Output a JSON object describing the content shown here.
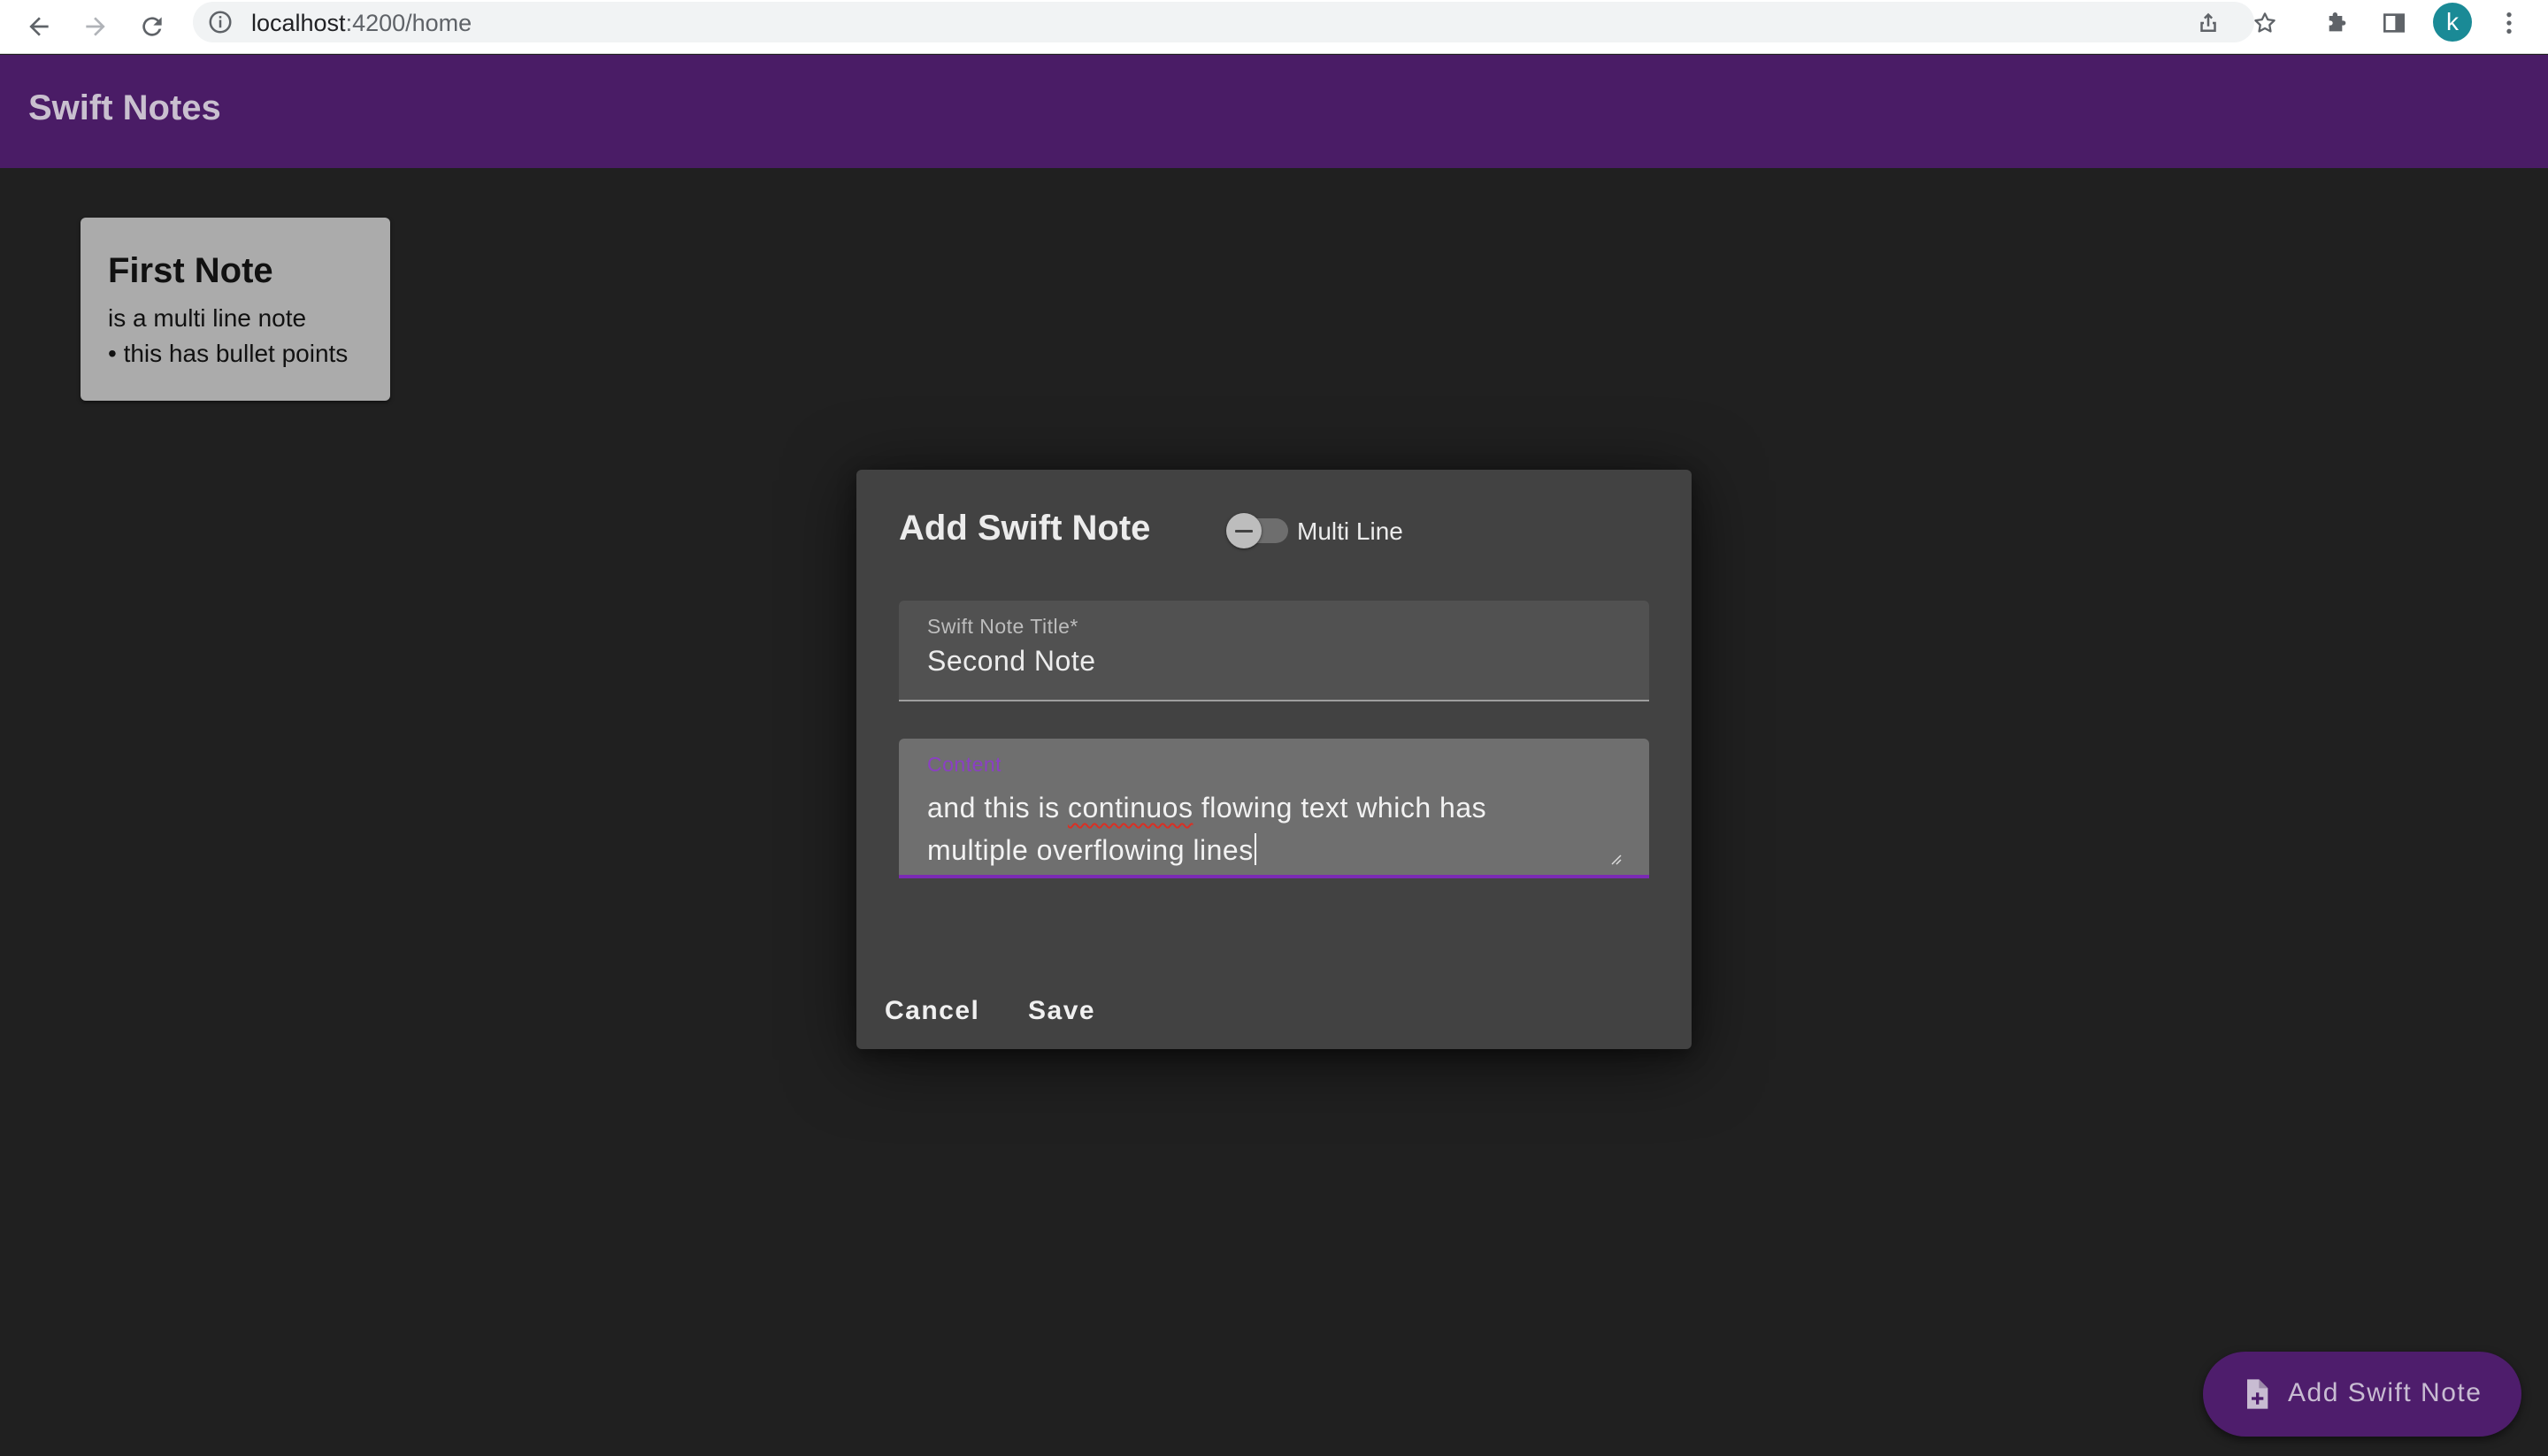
{
  "browser": {
    "url_host": "localhost",
    "url_path": ":4200/home",
    "avatar_initial": "k",
    "icons": [
      "back-arrow-icon",
      "forward-arrow-icon",
      "reload-icon",
      "site-info-icon",
      "share-icon",
      "bookmark-star-icon",
      "extensions-puzzle-icon",
      "side-panel-icon",
      "kebab-menu-icon"
    ]
  },
  "app": {
    "title": "Swift Notes",
    "accent_color": "#4a1c66"
  },
  "notes": [
    {
      "title": "First Note",
      "lines": [
        "is a multi line note",
        "• this has bullet points"
      ]
    }
  ],
  "dialog": {
    "title": "Add Swift Note",
    "toggle_label": "Multi Line",
    "toggle_on": false,
    "title_field": {
      "label": "Swift Note Title*",
      "value": "Second Note"
    },
    "content_field": {
      "label": "Content",
      "line1_pre": "and this is ",
      "line1_misspelled": "continuos",
      "line1_post": " flowing text which has",
      "line2": "multiple overflowing lines"
    },
    "cancel_label": "Cancel",
    "save_label": "Save"
  },
  "fab": {
    "label": "Add Swift Note",
    "icon": "note-add-icon"
  }
}
